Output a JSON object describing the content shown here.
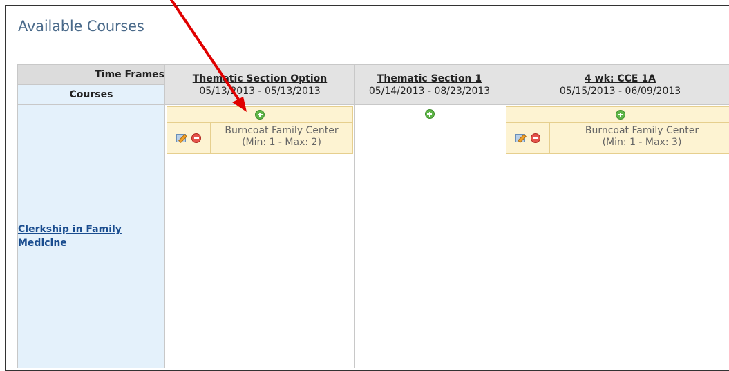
{
  "page": {
    "title": "Available Courses"
  },
  "grid": {
    "corner_top": "Time Frames",
    "corner_bottom": "Courses",
    "columns": [
      {
        "section": "Thematic Section Option",
        "dates": "05/13/2013 - 05/13/2013"
      },
      {
        "section": "Thematic Section 1",
        "dates": "05/14/2013 - 08/23/2013"
      },
      {
        "section": "4 wk: CCE 1A",
        "dates": "05/15/2013 - 06/09/2013"
      }
    ],
    "course": {
      "label": "Clerkship in Family Medicine"
    },
    "cells": [
      {
        "site": "Burncoat Family Center",
        "capacity": "(Min: 1 - Max: 2)"
      },
      null,
      {
        "site": "Burncoat Family Center",
        "capacity": "(Min: 1 - Max: 3)"
      }
    ]
  },
  "icons": {
    "add": "plus-circle-icon",
    "edit": "edit-icon",
    "remove": "minus-circle-icon"
  },
  "colors": {
    "title": "#4a6a8a",
    "link": "#1a4d8f",
    "option_bg": "#fdf3d2",
    "course_bg": "#e4f1fb",
    "header_bg": "#e3e3e3",
    "annotation_arrow": "#e00000"
  }
}
